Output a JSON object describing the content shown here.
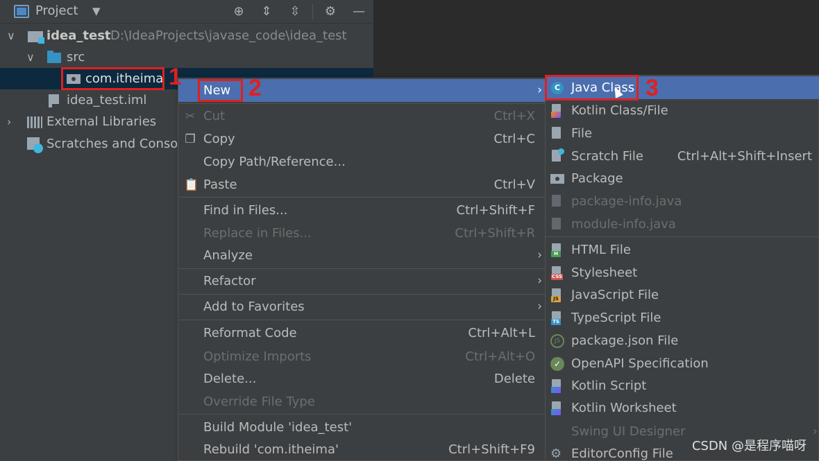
{
  "project_panel": {
    "title": "Project",
    "tree": {
      "root_name": "idea_test",
      "root_path": "D:\\IdeaProjects\\javase_code\\idea_test",
      "src": "src",
      "package": "com.itheima",
      "iml_file": "idea_test.iml",
      "external_libraries": "External Libraries",
      "scratches": "Scratches and Conso"
    }
  },
  "context_menu": {
    "new": "New",
    "cut": {
      "label": "Cut",
      "shortcut": "Ctrl+X"
    },
    "copy": {
      "label": "Copy",
      "shortcut": "Ctrl+C"
    },
    "copy_path": "Copy Path/Reference...",
    "paste": {
      "label": "Paste",
      "shortcut": "Ctrl+V"
    },
    "find_in_files": {
      "label": "Find in Files...",
      "shortcut": "Ctrl+Shift+F"
    },
    "replace_in_files": {
      "label": "Replace in Files...",
      "shortcut": "Ctrl+Shift+R"
    },
    "analyze": "Analyze",
    "refactor": "Refactor",
    "add_to_favorites": "Add to Favorites",
    "reformat_code": {
      "label": "Reformat Code",
      "shortcut": "Ctrl+Alt+L"
    },
    "optimize_imports": {
      "label": "Optimize Imports",
      "shortcut": "Ctrl+Alt+O"
    },
    "delete": {
      "label": "Delete...",
      "shortcut": "Delete"
    },
    "override_file_type": "Override File Type",
    "build_module": "Build Module 'idea_test'",
    "rebuild": {
      "label": "Rebuild 'com.itheima'",
      "shortcut": "Ctrl+Shift+F9"
    }
  },
  "submenu": {
    "java_class": "Java Class",
    "kotlin_class": "Kotlin Class/File",
    "file": "File",
    "scratch_file": {
      "label": "Scratch File",
      "shortcut": "Ctrl+Alt+Shift+Insert"
    },
    "package": "Package",
    "package_info": "package-info.java",
    "module_info": "module-info.java",
    "html_file": "HTML File",
    "stylesheet": "Stylesheet",
    "javascript_file": "JavaScript File",
    "typescript_file": "TypeScript File",
    "package_json": "package.json File",
    "openapi": "OpenAPI Specification",
    "kotlin_script": "Kotlin Script",
    "kotlin_worksheet": "Kotlin Worksheet",
    "swing_ui": "Swing UI Designer",
    "editorconfig": "EditorConfig File"
  },
  "annotations": {
    "step1": "1",
    "step2": "2",
    "step3": "3"
  },
  "watermark": "CSDN @是程序喵呀",
  "colors": {
    "highlight": "#4b6eaf",
    "annotation_red": "#e02020",
    "panel_bg": "#3c3f41",
    "selection_bg": "#0d293e"
  }
}
